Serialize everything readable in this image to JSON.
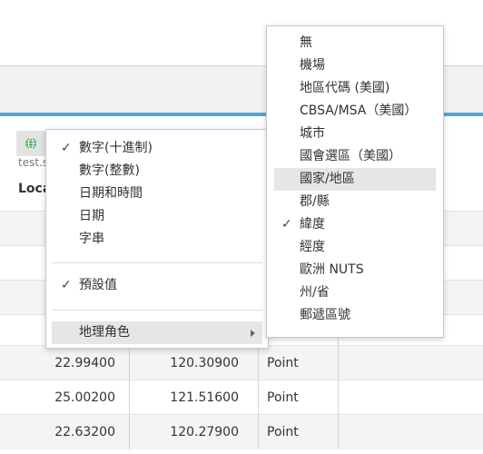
{
  "table": {
    "source_label": "test.s",
    "field_name": "Loca",
    "rows": [
      {
        "v1": "22.99400",
        "v2": "120.30900",
        "v3": "Point"
      },
      {
        "v1": "25.00200",
        "v2": "121.51600",
        "v3": "Point"
      },
      {
        "v1": "22.63200",
        "v2": "120.27900",
        "v3": "Point"
      }
    ]
  },
  "context_menu": {
    "items": [
      {
        "label": "數字(十進制)",
        "checked": true
      },
      {
        "label": "數字(整數)",
        "checked": false
      },
      {
        "label": "日期和時間",
        "checked": false
      },
      {
        "label": "日期",
        "checked": false
      },
      {
        "label": "字串",
        "checked": false
      }
    ],
    "default_label": "預設值",
    "geo_role_label": "地理角色",
    "check_glyph": "✓"
  },
  "geo_submenu": {
    "items": [
      {
        "label": "無",
        "checked": false
      },
      {
        "label": "機場",
        "checked": false
      },
      {
        "label": "地區代碼 (美國)",
        "checked": false
      },
      {
        "label": "CBSA/MSA（美國）",
        "checked": false
      },
      {
        "label": "城市",
        "checked": false
      },
      {
        "label": "國會選區（美國）",
        "checked": false
      },
      {
        "label": "國家/地區",
        "checked": false,
        "hover": true
      },
      {
        "label": "郡/縣",
        "checked": false
      },
      {
        "label": "緯度",
        "checked": true
      },
      {
        "label": "經度",
        "checked": false
      },
      {
        "label": "歐洲 NUTS",
        "checked": false
      },
      {
        "label": "州/省",
        "checked": false
      },
      {
        "label": "郵遞區號",
        "checked": false
      }
    ]
  },
  "colors": {
    "accent": "#5ba4c9",
    "globe": "#3aa657"
  },
  "icons": {
    "geo_badge": "globe-icon",
    "check": "checkmark-icon",
    "submenu": "chevron-right-icon"
  }
}
